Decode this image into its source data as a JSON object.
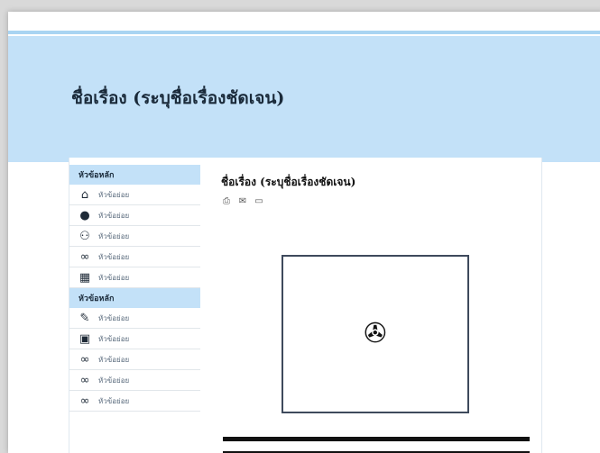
{
  "site_title": "ชื่อเรื่อง (ระบุชื่อเรื่องชัดเจน)",
  "sidebar": {
    "groups": [
      {
        "header": "หัวข้อหลัก",
        "items": [
          {
            "icon": "home-icon",
            "glyph": "⌂",
            "label": "หัวข้อย่อย"
          },
          {
            "icon": "chat-icon",
            "glyph": "●",
            "label": "หัวข้อย่อย"
          },
          {
            "icon": "users-icon",
            "glyph": "⚇",
            "label": "หัวข้อย่อย"
          },
          {
            "icon": "link-icon",
            "glyph": "∞",
            "label": "หัวข้อย่อย"
          },
          {
            "icon": "calendar-icon",
            "glyph": "▦",
            "label": "หัวข้อย่อย"
          }
        ]
      },
      {
        "header": "หัวข้อหลัก",
        "items": [
          {
            "icon": "edit-icon",
            "glyph": "✎",
            "label": "หัวข้อย่อย"
          },
          {
            "icon": "image-icon",
            "glyph": "▣",
            "label": "หัวข้อย่อย"
          },
          {
            "icon": "link-icon",
            "glyph": "∞",
            "label": "หัวข้อย่อย"
          },
          {
            "icon": "link-icon",
            "glyph": "∞",
            "label": "หัวข้อย่อย"
          },
          {
            "icon": "link-icon",
            "glyph": "∞",
            "label": "หัวข้อย่อย"
          }
        ]
      }
    ]
  },
  "main": {
    "title": "ชื่อเรื่อง (ระบุชื่อเรื่องชัดเจน)",
    "tools": [
      {
        "icon": "print-icon",
        "glyph": "⎙"
      },
      {
        "icon": "email-icon",
        "glyph": "✉"
      },
      {
        "icon": "pdf-icon",
        "glyph": "▭"
      }
    ],
    "media_icon": "film-reel-icon",
    "media_glyph": "✇"
  }
}
